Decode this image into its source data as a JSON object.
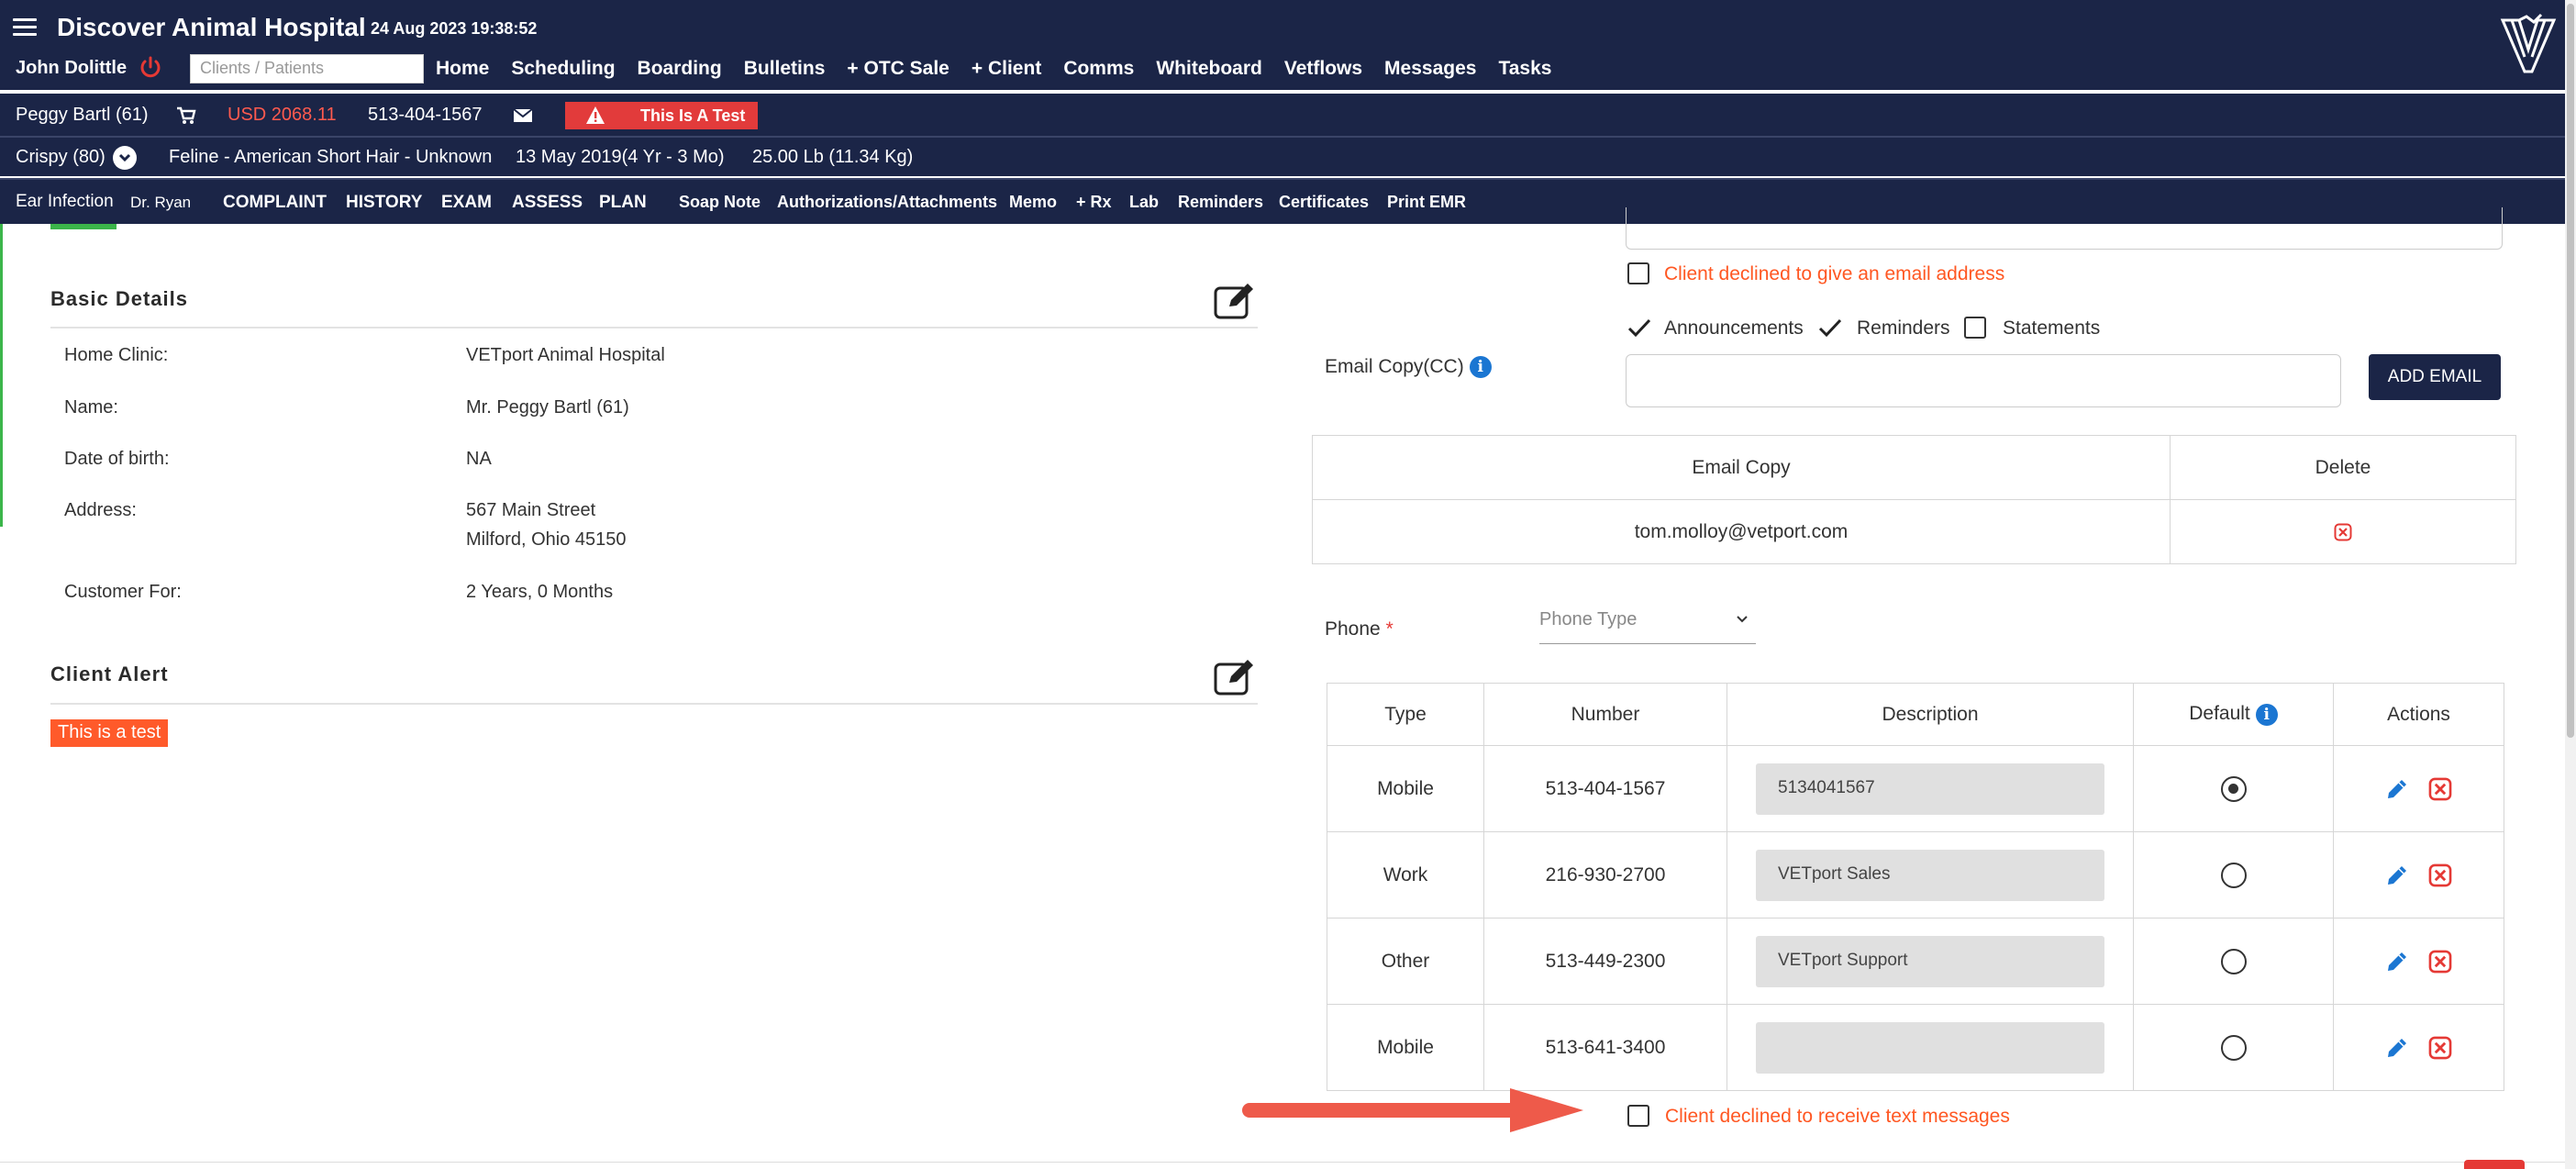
{
  "header": {
    "app_title": "Discover Animal Hospital",
    "datetime": "24 Aug 2023 19:38:52",
    "user_name": "John Dolittle",
    "search_placeholder": "Clients / Patients",
    "nav": [
      "Home",
      "Scheduling",
      "Boarding",
      "Bulletins",
      "+ OTC Sale",
      "+ Client",
      "Comms",
      "Whiteboard",
      "Vetflows",
      "Messages",
      "Tasks"
    ]
  },
  "client_bar": {
    "client": "Peggy Bartl (61)",
    "balance": "USD 2068.11",
    "phone": "513-404-1567",
    "alert_badge": "This Is A Test"
  },
  "patient_bar": {
    "patient": "Crispy (80)",
    "breed": "Feline - American Short Hair - Unknown",
    "dob": "13 May 2019(4 Yr - 3 Mo)",
    "weight": "25.00 Lb (11.34 Kg)"
  },
  "visit_bar": {
    "visit": "Ear Infection",
    "doctor": "Dr. Ryan",
    "tabs": [
      "COMPLAINT",
      "HISTORY",
      "EXAM",
      "ASSESS",
      "PLAN",
      "Soap Note",
      "Authorizations/Attachments",
      "Memo",
      "+ Rx",
      "Lab",
      "Reminders",
      "Certificates",
      "Print EMR"
    ]
  },
  "basic_details": {
    "title": "Basic Details",
    "rows": [
      {
        "label": "Home Clinic:",
        "value": "VETport Animal Hospital"
      },
      {
        "label": "Name:",
        "value": "Mr. Peggy Bartl (61)"
      },
      {
        "label": "Date of birth:",
        "value": "NA"
      },
      {
        "label": "Address:",
        "value": "567 Main Street",
        "value2": "Milford, Ohio 45150"
      },
      {
        "label": "Customer For:",
        "value": "2 Years, 0 Months"
      }
    ]
  },
  "client_alert": {
    "title": "Client Alert",
    "tag": "This is a test"
  },
  "email": {
    "declined_email": "Client declined to give an email address",
    "prefs": [
      "Announcements",
      "Reminders",
      "Statements"
    ],
    "cc_label": "Email Copy(CC)",
    "add_button": "ADD EMAIL",
    "table_headers": [
      "Email Copy",
      "Delete"
    ],
    "copies": [
      "tom.molloy@vetport.com"
    ]
  },
  "phone": {
    "label": "Phone",
    "required_mark": "*",
    "type_placeholder": "Phone Type",
    "headers": [
      "Type",
      "Number",
      "Description",
      "Default",
      "Actions"
    ],
    "rows": [
      {
        "type": "Mobile",
        "number": "513-404-1567",
        "description": "5134041567",
        "default": true
      },
      {
        "type": "Work",
        "number": "216-930-2700",
        "description": "VETport Sales",
        "default": false
      },
      {
        "type": "Other",
        "number": "513-449-2300",
        "description": "VETport Support",
        "default": false
      },
      {
        "type": "Mobile",
        "number": "513-641-3400",
        "description": "",
        "default": false
      }
    ],
    "declined_text": "Client declined to receive text messages"
  },
  "colors": {
    "navy": "#1b2547",
    "orange": "#ff5722",
    "alert_red": "#e23b3b",
    "accent_blue": "#1b76d2",
    "green": "#3bb54a"
  }
}
